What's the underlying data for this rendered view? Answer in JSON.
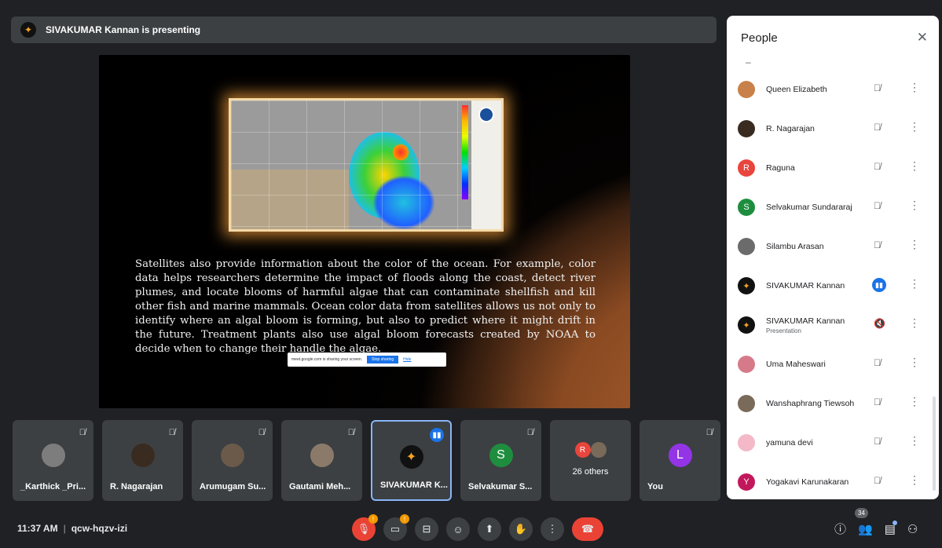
{
  "presenting_banner": "SIVAKUMAR Kannan is presenting",
  "slide": {
    "text": "Satellites also provide information about the color of the ocean. For example, color data helps researchers determine the impact of floods along the coast, detect river plumes, and locate blooms of harmful algae that can contaminate shellfish and kill other fish and marine mammals. Ocean color data from satellites allows us not only to identify where an algal bloom is forming, but also to predict where it might drift in the future. Treatment plants also use algal bloom forecasts created by NOAA to decide when to change their handle the algae.",
    "share_notice": "meet.google.com is sharing your screen.",
    "stop_sharing": "Stop sharing",
    "hide": "Hide"
  },
  "tiles": [
    {
      "name": "_Karthick _Pri...",
      "muted": true
    },
    {
      "name": "R. Nagarajan",
      "muted": true
    },
    {
      "name": "Arumugam Su...",
      "muted": true
    },
    {
      "name": "Gautami Meh...",
      "muted": true
    },
    {
      "name": "SIVAKUMAR K...",
      "speaking": true
    },
    {
      "name": "Selvakumar S...",
      "initial": "S",
      "muted": true
    },
    {
      "others": "26 others",
      "initials": [
        "R",
        ""
      ]
    },
    {
      "name": "You",
      "initial": "L",
      "muted": true
    }
  ],
  "meeting": {
    "time": "11:37 AM",
    "code": "qcw-hqzv-izi"
  },
  "people_count": "34",
  "panel": {
    "title": "People",
    "dash": "–",
    "people": [
      {
        "name": "Queen Elizabeth",
        "color": "#c8814a"
      },
      {
        "name": "R. Nagarajan",
        "color": "#3a2b20"
      },
      {
        "name": "Raguna",
        "initial": "R",
        "color": "#e8453c"
      },
      {
        "name": "Selvakumar Sundararaj",
        "initial": "S",
        "color": "#1e8e3e"
      },
      {
        "name": "Silambu Arasan",
        "color": "#6b6b6b"
      },
      {
        "name": "SIVAKUMAR Kannan",
        "color": "#111111",
        "speaking": true
      },
      {
        "name": "SIVAKUMAR Kannan",
        "sub": "Presentation",
        "color": "#111111",
        "presentation": true
      },
      {
        "name": "Uma Maheswari",
        "color": "#d67a8a"
      },
      {
        "name": "Wanshaphrang Tiewsoh",
        "color": "#7a6a5a"
      },
      {
        "name": "yamuna devi",
        "color": "#f4b8c8"
      },
      {
        "name": "Yogakavi Karunakaran",
        "initial": "Y",
        "color": "#c2185b"
      }
    ]
  }
}
